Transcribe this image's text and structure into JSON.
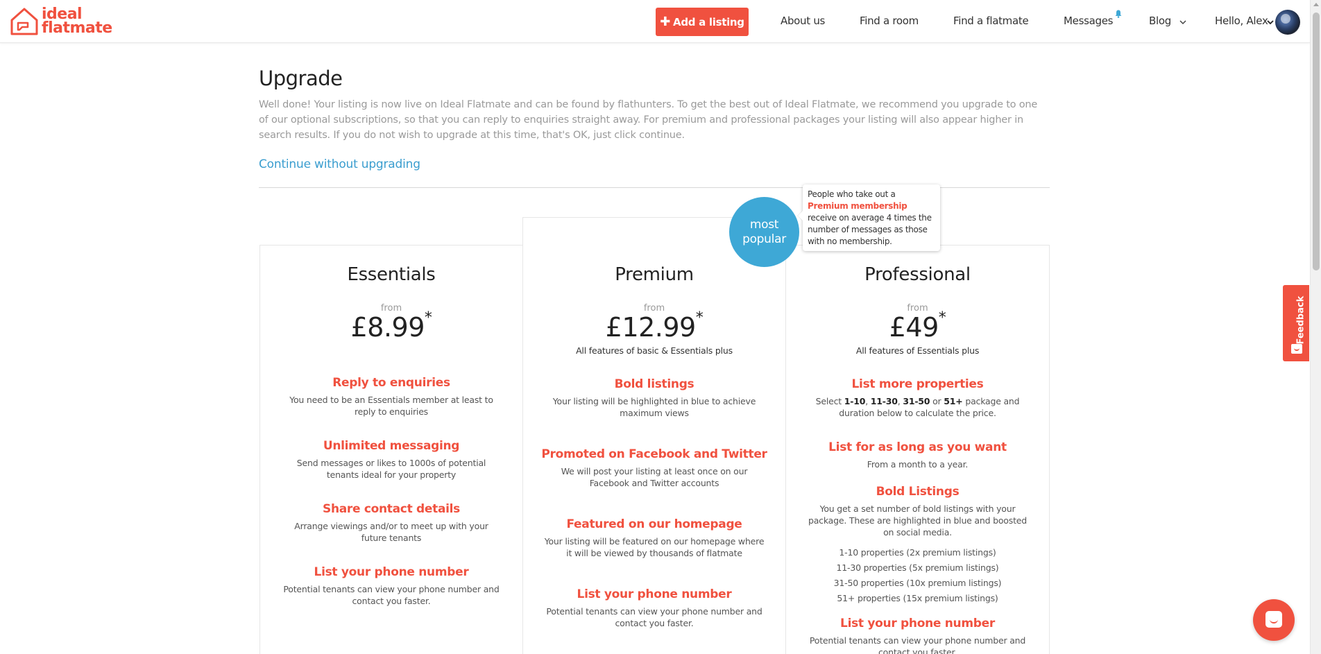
{
  "header": {
    "logo_line1": "ideal",
    "logo_line2": "flatmate",
    "add_listing": "Add a listing",
    "nav": {
      "about": "About us",
      "find_room": "Find a room",
      "find_flatmate": "Find a flatmate",
      "messages": "Messages",
      "blog": "Blog",
      "greeting": "Hello, Alex"
    }
  },
  "intro": {
    "title": "Upgrade",
    "text": "Well done! Your listing is now live on Ideal Flatmate and can be found by flathunters. To get the best out of Ideal Flatmate, we recommend you upgrade to one of our optional subscriptions, so that you can reply to enquiries straight away. For premium and professional packages your listing will also appear higher in search results. If you do not wish to upgrade at this time, that's OK, just click continue.",
    "continue_link": "Continue without upgrading"
  },
  "badge": {
    "line1": "most",
    "line2": "popular"
  },
  "tooltip": {
    "pre": "People who take out a",
    "highlight": "Premium membership",
    "post": "receive on average 4 times the number of messages as those with no membership."
  },
  "plans": {
    "essentials": {
      "name": "Essentials",
      "from": "from",
      "price": "£8.99",
      "asterisk": "*",
      "features": [
        {
          "title": "Reply to enquiries",
          "desc": "You need to be an Essentials member at least to reply to enquiries"
        },
        {
          "title": "Unlimited messaging",
          "desc": "Send messages or likes to 1000s of potential tenants ideal for your property"
        },
        {
          "title": "Share contact details",
          "desc": "Arrange viewings and/or to meet up with your future tenants"
        },
        {
          "title": "List your phone number",
          "desc": "Potential tenants can view your phone number and contact you faster."
        }
      ]
    },
    "premium": {
      "name": "Premium",
      "from": "from",
      "price": "£12.99",
      "asterisk": "*",
      "plus": "All features of basic & Essentials plus",
      "features": [
        {
          "title": "Bold listings",
          "desc": "Your listing will be highlighted in blue to achieve maximum views"
        },
        {
          "title": "Promoted on Facebook and Twitter",
          "desc": "We will post your listing at least once on our Facebook and Twitter accounts"
        },
        {
          "title": "Featured on our homepage",
          "desc": "Your listing will be featured on our homepage where it will be viewed by thousands of flatmate"
        },
        {
          "title": "List your phone number",
          "desc": "Potential tenants can view your phone number and contact you faster."
        }
      ]
    },
    "professional": {
      "name": "Professional",
      "from": "from",
      "price": "£49",
      "asterisk": "*",
      "plus": "All features of Essentials plus",
      "f1_title": "List more properties",
      "f1_desc_a": "Select",
      "f1_opt1": "1-10",
      "f1_opt2": "11-30",
      "f1_opt3": "31-50",
      "f1_or": "or",
      "f1_opt4": "51+",
      "f1_desc_b": "package and duration below to calculate the price.",
      "f2_title": "List for as long as you want",
      "f2_desc": "From a month to a year.",
      "f3_title": "Bold Listings",
      "f3_desc": "You get a set number of bold listings with your package. These are highlighted in blue and boosted on social media.",
      "packages": [
        "1-10 properties (2x premium listings)",
        "11-30 properties (5x premium listings)",
        "31-50 properties (10x premium listings)",
        "51+ properties (15x premium listings)"
      ],
      "f4_title": "List your phone number",
      "f4_desc": "Potential tenants can view your phone number and contact you faster."
    }
  },
  "feedback": "Feedback",
  "colors": {
    "brand": "#f0513f",
    "link": "#3a9dcf",
    "badge": "#3ea8d6"
  }
}
